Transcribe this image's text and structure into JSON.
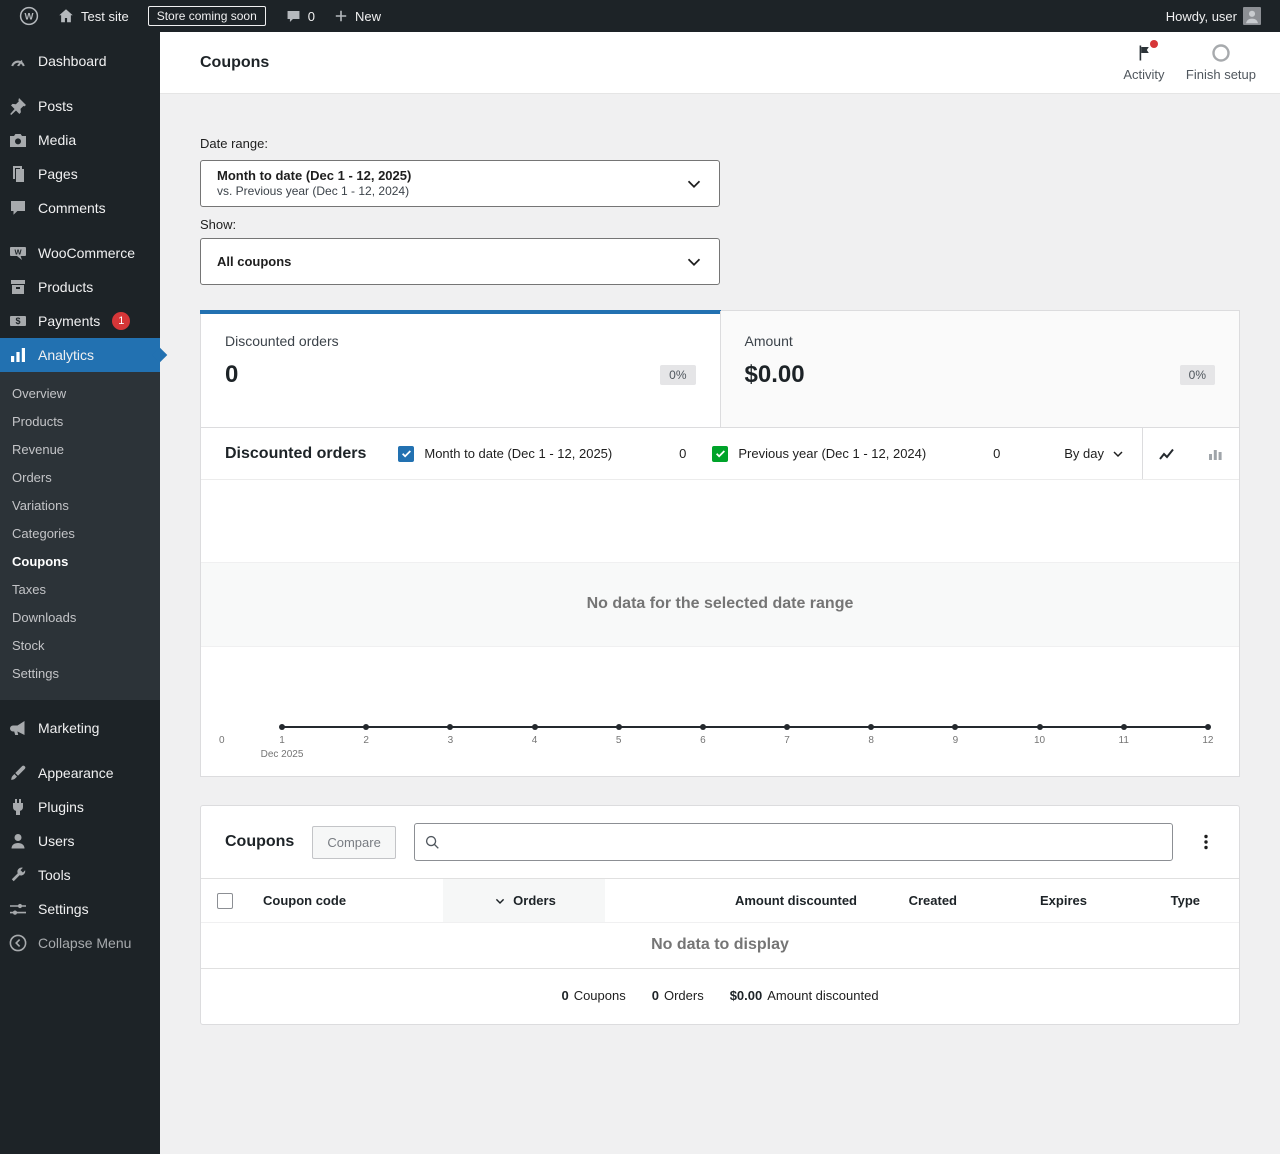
{
  "colors": {
    "accent": "#2271b1",
    "series_primary": "#2271b1",
    "series_secondary": "#00a32a",
    "notification_red": "#d63638"
  },
  "icons": {
    "wordpress-logo-icon": "circled-W",
    "home-icon": "house",
    "comments-bubble-icon": "speech-bubble",
    "new-plus-icon": "plus",
    "dashboard-icon": "gauge",
    "posts-icon": "pushpin",
    "media-icon": "camera",
    "pages-icon": "stacked-documents",
    "comments-icon": "speech-bubble",
    "woocommerce-icon": "w-speech-bubble",
    "products-icon": "archive-box",
    "payments-icon": "banknote-dollar",
    "analytics-icon": "bar-chart",
    "marketing-icon": "megaphone",
    "appearance-icon": "paintbrush",
    "plugins-icon": "plug",
    "users-icon": "person",
    "tools-icon": "wrench",
    "settings-icon": "sliders",
    "collapse-icon": "left-arrow-circle",
    "flag-icon": "flag-with-red-dot",
    "progress-circle-icon": "ring",
    "chevron-down-icon": "chevron-down",
    "checkbox-checked-icon": "checkmark-in-square",
    "line-chart-icon": "polyline",
    "bar-chart-icon": "bars",
    "search-icon": "magnifier",
    "kebab-menu-icon": "vertical-ellipsis",
    "sort-descending-icon": "chevron-down"
  },
  "admin_bar": {
    "site_name": "Test site",
    "store_badge": "Store coming soon",
    "comments_count": "0",
    "new_label": "New",
    "howdy": "Howdy, user"
  },
  "sidebar": {
    "items": [
      {
        "label": "Dashboard"
      },
      {
        "label": "Posts"
      },
      {
        "label": "Media"
      },
      {
        "label": "Pages"
      },
      {
        "label": "Comments"
      },
      {
        "label": "WooCommerce"
      },
      {
        "label": "Products"
      },
      {
        "label": "Payments",
        "badge": "1"
      },
      {
        "label": "Analytics"
      },
      {
        "label": "Marketing"
      },
      {
        "label": "Appearance"
      },
      {
        "label": "Plugins"
      },
      {
        "label": "Users"
      },
      {
        "label": "Tools"
      },
      {
        "label": "Settings"
      },
      {
        "label": "Collapse Menu"
      }
    ],
    "analytics_submenu": [
      "Overview",
      "Products",
      "Revenue",
      "Orders",
      "Variations",
      "Categories",
      "Coupons",
      "Taxes",
      "Downloads",
      "Stock",
      "Settings"
    ],
    "active_item": "Analytics",
    "active_submenu": "Coupons"
  },
  "header": {
    "title": "Coupons",
    "activity_label": "Activity",
    "finish_setup_label": "Finish setup"
  },
  "filters": {
    "date_range_label": "Date range:",
    "date_range_primary": "Month to date (Dec 1 - 12, 2025)",
    "date_range_secondary": "vs. Previous year (Dec 1 - 12, 2024)",
    "show_label": "Show:",
    "show_value": "All coupons"
  },
  "summary_tiles": [
    {
      "label": "Discounted orders",
      "value": "0",
      "delta": "0%"
    },
    {
      "label": "Amount",
      "value": "$0.00",
      "delta": "0%"
    }
  ],
  "chart": {
    "title": "Discounted orders",
    "legend": [
      {
        "label": "Month to date (Dec 1 - 12, 2025)",
        "value": "0",
        "color": "#2271b1"
      },
      {
        "label": "Previous year (Dec 1 - 12, 2024)",
        "value": "0",
        "color": "#00a32a"
      }
    ],
    "interval_label": "By day",
    "empty_message": "No data for the selected date range",
    "y_ticks": [
      "0"
    ],
    "x_ticks": [
      "1",
      "2",
      "3",
      "4",
      "5",
      "6",
      "7",
      "8",
      "9",
      "10",
      "11",
      "12"
    ],
    "x_sub_label": "Dec 2025"
  },
  "chart_data": {
    "type": "line",
    "title": "Discounted orders",
    "x": [
      1,
      2,
      3,
      4,
      5,
      6,
      7,
      8,
      9,
      10,
      11,
      12
    ],
    "x_axis_label": "Dec 2025",
    "series": [
      {
        "name": "Month to date (Dec 1 - 12, 2025)",
        "values": []
      },
      {
        "name": "Previous year (Dec 1 - 12, 2024)",
        "values": []
      }
    ],
    "ylim": [
      0,
      1
    ],
    "empty": true,
    "legend_position": "top"
  },
  "table": {
    "title": "Coupons",
    "compare_label": "Compare",
    "search_placeholder": "",
    "search_value": "",
    "columns": [
      "Coupon code",
      "Orders",
      "Amount discounted",
      "Created",
      "Expires",
      "Type"
    ],
    "sorted_column": "Orders",
    "rows": [],
    "empty_message": "No data to display",
    "summary": [
      {
        "value": "0",
        "label": "Coupons"
      },
      {
        "value": "0",
        "label": "Orders"
      },
      {
        "value": "$0.00",
        "label": "Amount discounted"
      }
    ]
  }
}
